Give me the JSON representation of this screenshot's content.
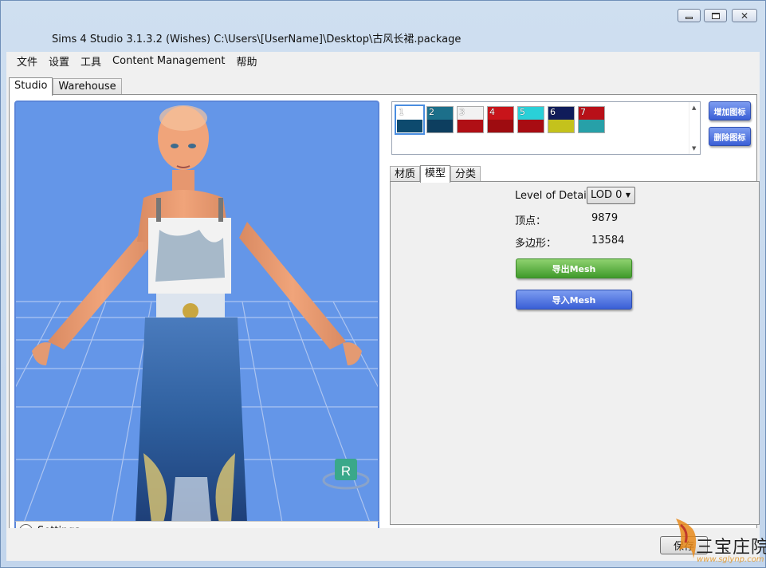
{
  "window": {
    "title": "Sims 4 Studio 3.1.3.2 (Wishes)  C:\\Users\\[UserName]\\Desktop\\古风长裙.package",
    "controls": [
      "minimize-icon",
      "maximize-icon",
      "close-icon"
    ],
    "close_glyph": "✕"
  },
  "menu": [
    "文件",
    "设置",
    "工具",
    "Content Management",
    "帮助"
  ],
  "tabs": [
    {
      "label": "Studio",
      "active": true
    },
    {
      "label": "Warehouse",
      "active": false
    }
  ],
  "viewport": {
    "settings_label": "Settings",
    "badge": "R",
    "background_color": "#6496e8"
  },
  "swatches": [
    {
      "num": "1",
      "top": "#ffffff",
      "bottom": "#0d4a6e",
      "selected": true
    },
    {
      "num": "2",
      "top": "#1c6f8a",
      "bottom": "#0d3e5f",
      "selected": false
    },
    {
      "num": "3",
      "top": "#f2f2f2",
      "bottom": "#b00f15",
      "selected": false
    },
    {
      "num": "4",
      "top": "#c8141a",
      "bottom": "#9e0c10",
      "selected": false
    },
    {
      "num": "5",
      "top": "#2ad0d8",
      "bottom": "#a80c12",
      "selected": false
    },
    {
      "num": "6",
      "top": "#101c5a",
      "bottom": "#c4c21c",
      "selected": false
    },
    {
      "num": "7",
      "top": "#b81018",
      "bottom": "#27a0a8",
      "selected": false
    }
  ],
  "side_buttons": {
    "add": "增加图标",
    "remove": "删除图标"
  },
  "sub_tabs": [
    {
      "label": "材质",
      "active": false
    },
    {
      "label": "模型",
      "active": true
    },
    {
      "label": "分类",
      "active": false
    }
  ],
  "model": {
    "lod_label": "Level of Detail:",
    "lod_value": "LOD 0",
    "vertices_label": "顶点：",
    "vertices_value": "9879",
    "polygons_label": "多边形：",
    "polygons_value": "13584",
    "export_label": "导出Mesh",
    "import_label": "导入Mesh"
  },
  "footer": {
    "save_label": "保存"
  },
  "watermark": {
    "text": "三宝庄院",
    "url": "www.sglynp.com"
  }
}
